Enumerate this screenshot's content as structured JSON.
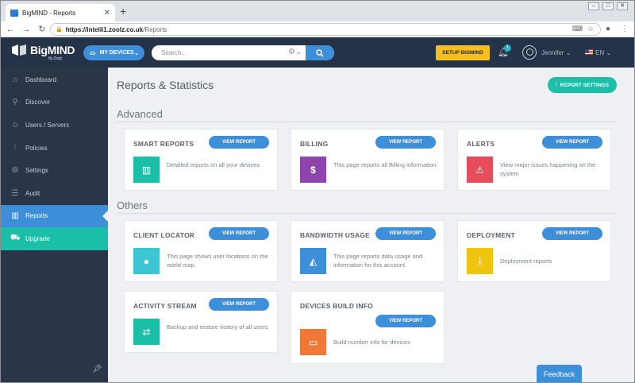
{
  "browser": {
    "tab_title": "BigMIND - Reports",
    "url_host": "https://intelli1.zoolz.co.uk",
    "url_path": "/Reports"
  },
  "header": {
    "logo_text": "BigMIND",
    "logo_sub": "By Zoolz",
    "my_devices": "MY DEVICES",
    "search_placeholder": "Search...",
    "setup_button": "SETUP BIGMIND",
    "notification_count": "1",
    "user_name": "Jennifer",
    "language": "EN"
  },
  "sidebar": {
    "items": [
      {
        "label": "Dashboard",
        "icon": "home-icon"
      },
      {
        "label": "Discover",
        "icon": "search-icon"
      },
      {
        "label": "Users / Servers",
        "icon": "users-icon"
      },
      {
        "label": "Policies",
        "icon": "sliders-icon"
      },
      {
        "label": "Settings",
        "icon": "gear-icon"
      },
      {
        "label": "Audit",
        "icon": "list-icon"
      },
      {
        "label": "Reports",
        "icon": "bar-chart-icon",
        "active": true
      },
      {
        "label": "Upgrade",
        "icon": "cart-icon"
      }
    ]
  },
  "main": {
    "title": "Reports & Statistics",
    "report_settings": "REPORT SETTINGS",
    "sections": {
      "advanced": "Advanced",
      "others": "Others"
    },
    "view_report_label": "VIEW REPORT",
    "cards": [
      {
        "title": "SMART REPORTS",
        "desc": "Detailed reports on all your devices",
        "color": "#1bbfa7",
        "icon": "bar-chart-icon"
      },
      {
        "title": "BILLING",
        "desc": "This page reports all Billing information.",
        "color": "#8e44ad",
        "icon": "dollar-icon"
      },
      {
        "title": "ALERTS",
        "desc": "View major issues happening on the system",
        "color": "#e74c5c",
        "icon": "warning-icon"
      },
      {
        "title": "CLIENT LOCATOR",
        "desc": "This page shows user locations on the world map.",
        "color": "#3cc6d4",
        "icon": "globe-icon"
      },
      {
        "title": "BANDWIDTH USAGE",
        "desc": "This page reports data usage and information for this account.",
        "color": "#3c8fd8",
        "icon": "area-chart-icon"
      },
      {
        "title": "DEPLOYMENT",
        "desc": "Deployment reports",
        "color": "#f1c40f",
        "icon": "download-icon"
      },
      {
        "title": "ACTIVITY STREAM",
        "desc": "Backup and restore history of all users",
        "color": "#1bbfa7",
        "icon": "exchange-icon"
      },
      {
        "title": "DEVICES BUILD INFO",
        "desc": "Build number info for devices",
        "color": "#f0793a",
        "icon": "monitor-icon"
      }
    ]
  },
  "feedback": "Feedback"
}
